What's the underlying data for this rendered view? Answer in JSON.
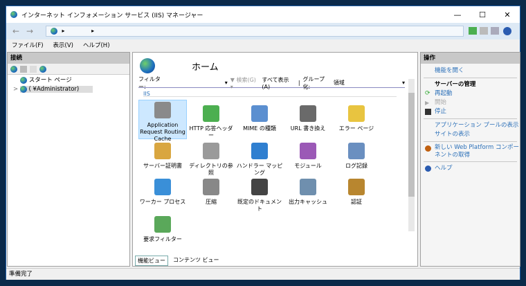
{
  "window": {
    "title": "インターネット インフォメーション サービス (IIS) マネージャー",
    "minimize": "—",
    "maximize": "☐",
    "close": "✕"
  },
  "address": {
    "back": "←",
    "forward": "→",
    "crumbs": [
      "▸",
      "▸"
    ]
  },
  "menu": [
    "ファイル(F)",
    "表示(V)",
    "ヘルプ(H)"
  ],
  "connections": {
    "title": "接続",
    "tree": [
      {
        "label": "スタート ページ"
      },
      {
        "label": "(           ¥Administrator)",
        "expander": ">"
      }
    ]
  },
  "home": {
    "title": "ホーム",
    "filter_label": "フィルター:",
    "filter_value": "",
    "search": "検索(G)",
    "show_all": "すべて表示(A)",
    "group_label": "グループ化:",
    "group_value": "領域",
    "section": "IIS",
    "features": [
      {
        "label": "Application Request Routing Cache",
        "color": "#8a8a8a"
      },
      {
        "label": "HTTP 応答ヘッダー",
        "color": "#4caf50"
      },
      {
        "label": "MIME の種類",
        "color": "#5b8fd0"
      },
      {
        "label": "URL 書き換え",
        "color": "#6a6a6a"
      },
      {
        "label": "エラー ページ",
        "color": "#e8c440"
      },
      {
        "label": "サーバー証明書",
        "color": "#d9a640"
      },
      {
        "label": "ディレクトリの参照",
        "color": "#9a9a9a"
      },
      {
        "label": "ハンドラー マッピング",
        "color": "#2f7fd0"
      },
      {
        "label": "モジュール",
        "color": "#9b59b6"
      },
      {
        "label": "ログ記録",
        "color": "#6a8fc0"
      },
      {
        "label": "ワーカー プロセス",
        "color": "#3a8fd8"
      },
      {
        "label": "圧縮",
        "color": "#888888"
      },
      {
        "label": "既定のドキュメント",
        "color": "#444444"
      },
      {
        "label": "出力キャッシュ",
        "color": "#6f8fae"
      },
      {
        "label": "認証",
        "color": "#b8862f"
      },
      {
        "label": "要求フィルター",
        "color": "#5aa85a"
      }
    ],
    "views": [
      "機能ビュー",
      "コンテンツ ビュー"
    ]
  },
  "actions": {
    "title": "操作",
    "open_feature": "機能を開く",
    "server_manage": "サーバーの管理",
    "restart": "再起動",
    "start": "開始",
    "stop": "停止",
    "app_pools": "アプリケーション プールの表示",
    "sites": "サイトの表示",
    "web_platform": "新しい Web Platform コンポーネントの取得",
    "help": "ヘルプ"
  },
  "status": "準備完了"
}
